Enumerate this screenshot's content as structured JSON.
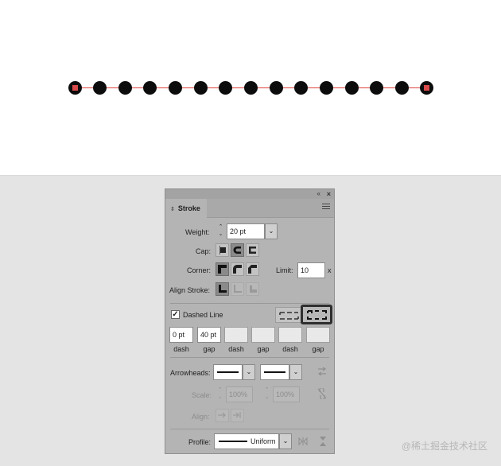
{
  "panel": {
    "tab_label": "Stroke",
    "weight_label": "Weight:",
    "weight_value": "20 pt",
    "cap_label": "Cap:",
    "corner_label": "Corner:",
    "limit_label": "Limit:",
    "limit_value": "10",
    "limit_unit": "x",
    "align_stroke_label": "Align Stroke:",
    "dashed_line_label": "Dashed Line",
    "dashed_line_checked": true,
    "dash_fields": [
      {
        "value": "0 pt",
        "label": "dash"
      },
      {
        "value": "40 pt",
        "label": "gap"
      },
      {
        "value": "",
        "label": "dash"
      },
      {
        "value": "",
        "label": "gap"
      },
      {
        "value": "",
        "label": "dash"
      },
      {
        "value": "",
        "label": "gap"
      }
    ],
    "arrowheads_label": "Arrowheads:",
    "scale_label": "Scale:",
    "scale_start": "100%",
    "scale_end": "100%",
    "align_label": "Align:",
    "profile_label": "Profile:",
    "profile_value": "Uniform"
  },
  "icons": {
    "collapse": "«",
    "close": "×",
    "tab_arrows": "⇕",
    "dropdown": "⌄",
    "checkmark": "✓"
  },
  "watermark": "@稀土掘金技术社区",
  "colors": {
    "path_guide": "#e0413a",
    "anchor": "#d94a4a",
    "dot": "#0c0c0c",
    "panel_bg": "#b4b4b4"
  }
}
